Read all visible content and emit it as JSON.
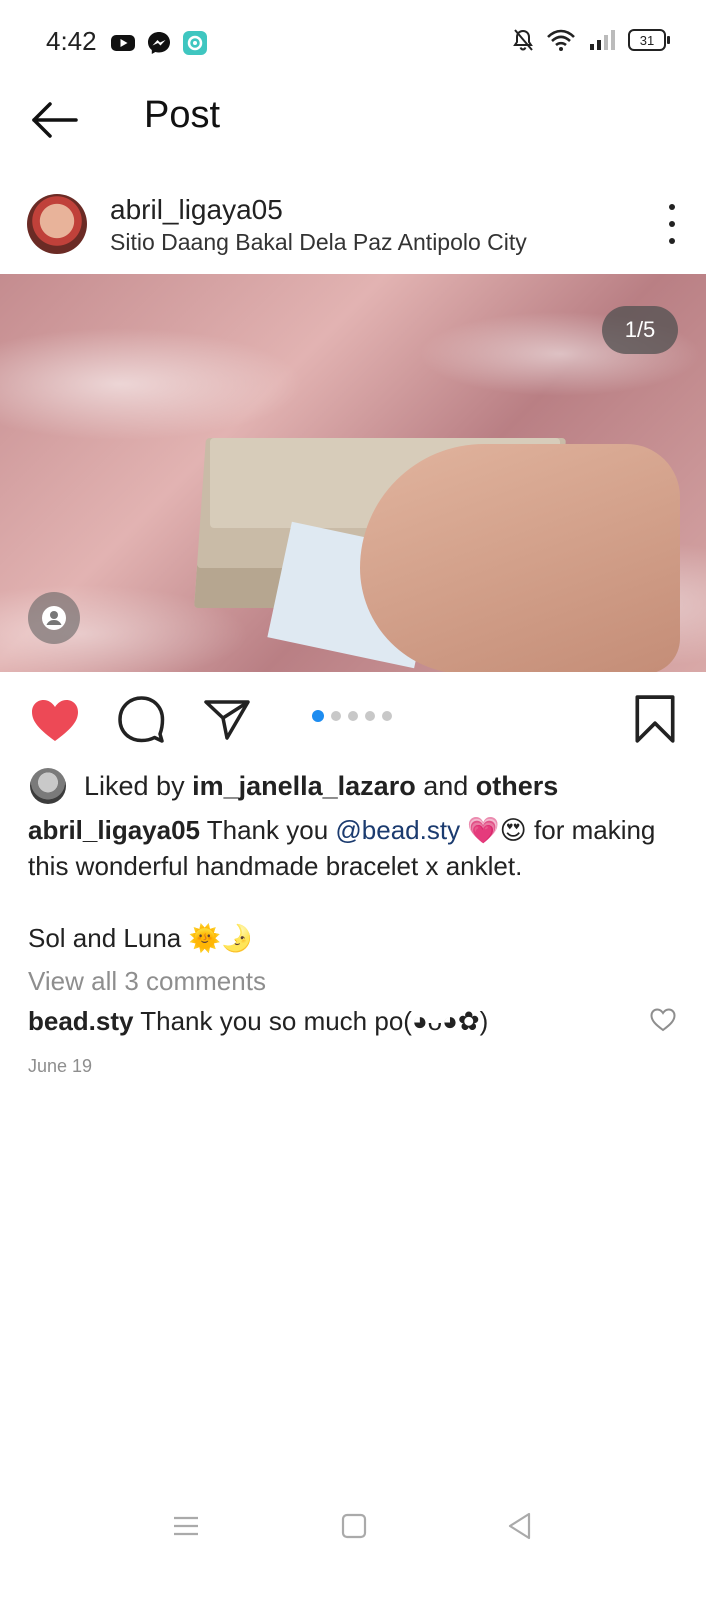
{
  "status_bar": {
    "time": "4:42",
    "battery": "31",
    "app_icons": [
      "youtube-icon",
      "messenger-icon",
      "app-icon"
    ],
    "system_icons": [
      "bell-off-icon",
      "wifi-icon",
      "signal-icon",
      "battery-icon"
    ]
  },
  "header": {
    "title": "Post"
  },
  "post": {
    "username": "abril_ligaya05",
    "location": "Sitio Daang Bakal Dela Paz Antipolo City",
    "media_counter": "1/5",
    "carousel": {
      "current": 1,
      "total": 5
    },
    "liked": true,
    "likes": {
      "prefix": "Liked by ",
      "user": "im_janella_lazaro",
      "middle": " and ",
      "others": "others"
    },
    "caption": {
      "username": "abril_ligaya05",
      "text_before": " Thank you ",
      "mention": "@bead.sty",
      "emojis": " 💗😍",
      "text_after": " for making this wonderful handmade bracelet x anklet.",
      "line2": "Sol and Luna 🌞🌛"
    },
    "view_comments": "View all 3 comments",
    "top_comment": {
      "username": "bead.sty",
      "text": " Thank you so much po(◕ᴗ◕✿)"
    },
    "date": "June 19"
  },
  "colors": {
    "like_red": "#ed4956",
    "carousel_active": "#1d8cf0",
    "mention": "#1b3b6f",
    "secondary_text": "#8e8e8e"
  }
}
